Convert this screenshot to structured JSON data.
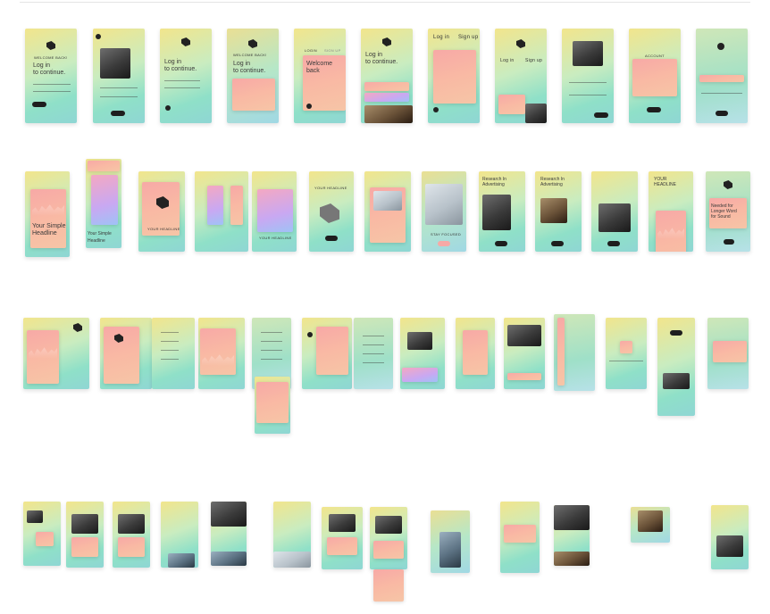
{
  "screens": {
    "welcome": "WELCOME BACK!",
    "login_continue": "Log in\nto continue.",
    "welcome_back": "Welcome\nback",
    "login_tab": "LOGIN",
    "signup_tab": "SIGN UP",
    "log_in": "Log in",
    "sign_up": "Sign up",
    "account": "ACCOUNT",
    "your_simple_headline": "Your Simple\nHeadline",
    "research_advertising": "Research In\nAdvertising",
    "needed_longer": "Needed for\nLonger Word\nfor Sound",
    "your_headline": "YOUR HEADLINE",
    "stay_focused": "STAY FOCUSED",
    "your_headline_short": "YOUR\nHEADLINE"
  },
  "colors": {
    "accent_pink": "#f7a9a6",
    "accent_mint": "#8fe0c8",
    "accent_yellow": "#f2e58c",
    "dark": "#1e1e1e"
  }
}
